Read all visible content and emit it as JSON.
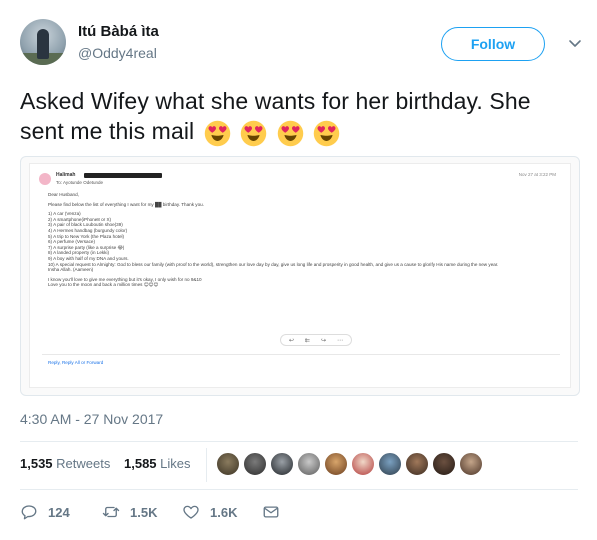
{
  "user": {
    "name": "Itú Bàbá ìta",
    "handle": "@Oddy4real"
  },
  "follow_label": "Follow",
  "tweet": {
    "text": "Asked Wifey what she wants for her birthday. She sent me this mail",
    "emoji": [
      "smiling-face-with-heart-eyes",
      "smiling-face-with-heart-eyes",
      "smiling-face-with-heart-eyes",
      "smiling-face-with-heart-eyes"
    ]
  },
  "email": {
    "from": "Halimah",
    "to": "To: Ayotunde Odetunde",
    "date": "Nov 27 at 3:22 PM",
    "greeting": "Dear Husband,",
    "intro": "Please find below the list of everything I want for my ██ birthday. Thank you.",
    "items": [
      "1) A car (Venza)",
      "2) A smartphone(iPhone8 or X)",
      "3) A pair of black Louboutin shoe(39)",
      "4) A Hermes handbag (burgundy color)",
      "5) A trip to New York (the Plaza hotel)",
      "6) A perfume (Versace)",
      "7) A surprise party (like a surprise 😂)",
      "8) A landed property (in Lekki)",
      "9) A boy with half of my DNA and yours.",
      "10) A special request to Almighty: God to bless our family (with proof to the world), strengthen our love day by day, give us long life and prosperity in good health, and give us a cause to glorify His name during the new year.",
      "Insha Allah. (Aameen)"
    ],
    "closing": [
      "I know you'll love to give me everything but it's okay, I only wish for no 9&10",
      "Love you to the moon and back a million times 😊😊😊"
    ],
    "action_icons": [
      "reply-icon",
      "reply-all-icon",
      "forward-icon",
      "more-icon"
    ],
    "reply_links": "Reply, Reply All or Forward"
  },
  "timestamp": "4:30 AM - 27 Nov 2017",
  "stats": {
    "retweets_count": "1,535",
    "retweets_label": "Retweets",
    "likes_count": "1,585",
    "likes_label": "Likes"
  },
  "likers": [
    "liker-1",
    "liker-2",
    "liker-3",
    "liker-4",
    "liker-5",
    "liker-6",
    "liker-7",
    "liker-8",
    "liker-9",
    "liker-10"
  ],
  "actions": {
    "replies": "124",
    "retweets": "1.5K",
    "likes": "1.6K"
  },
  "colors": {
    "accent": "#1da1f2",
    "text": "#14171a",
    "muted": "#657786",
    "border": "#e6ecf0"
  }
}
